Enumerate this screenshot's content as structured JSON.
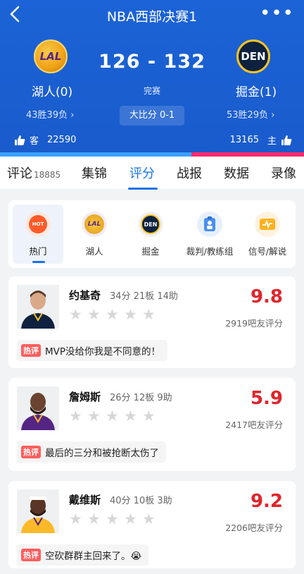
{
  "header": {
    "title": "NBA西部决赛1",
    "back_icon": "chevron-left-icon",
    "more_icon": "more-dots-icon",
    "more_text": "•••",
    "score": "126 - 132",
    "status": "完赛",
    "series": "大比分 0-1",
    "away": {
      "logo_text": "LAL",
      "name": "湖人(0)",
      "record": "43胜39负",
      "support_label": "客",
      "support_count": "22590"
    },
    "home": {
      "logo_text": "DEN",
      "name": "掘金(1)",
      "record": "53胜29负",
      "support_label": "主",
      "support_count": "13165"
    },
    "support_ratio": 0.63,
    "colors": {
      "header_bg": "#1b63d6",
      "away_bar": "#3aa0ff",
      "home_bar": "#ff2a6b"
    }
  },
  "tabs": {
    "items": [
      {
        "label": "评论",
        "sub": "18885"
      },
      {
        "label": "集锦"
      },
      {
        "label": "评分"
      },
      {
        "label": "战报"
      },
      {
        "label": "数据"
      },
      {
        "label": "录像"
      }
    ],
    "active_index": 2,
    "accent": "#1a73e8"
  },
  "filters": [
    {
      "label": "热门",
      "icon_text": "HOT"
    },
    {
      "label": "湖人",
      "icon_text": "LAL"
    },
    {
      "label": "掘金",
      "icon_text": "DEN"
    },
    {
      "label": "裁判/教练组",
      "icon_text": ""
    },
    {
      "label": "信号/解说",
      "icon_text": ""
    }
  ],
  "players": [
    {
      "name": "约基奇",
      "stats": "34分 21板 14助",
      "rating": "9.8",
      "count": "2919吧友评分",
      "hot_tag": "热评",
      "comment": "MVP没给你我是不同意的！",
      "jersey": "#0e2240"
    },
    {
      "name": "詹姆斯",
      "stats": "26分 12板 9助",
      "rating": "5.9",
      "count": "2417吧友评分",
      "hot_tag": "热评",
      "comment": "最后的三分和被抢断太伤了",
      "jersey": "#552583"
    },
    {
      "name": "戴维斯",
      "stats": "40分 10板 3助",
      "rating": "9.2",
      "count": "2206吧友评分",
      "hot_tag": "热评",
      "comment": "空砍群群主回来了。😭",
      "jersey": "#fdb927"
    }
  ],
  "star_glyph": "★",
  "rating_color": "#e0252b"
}
